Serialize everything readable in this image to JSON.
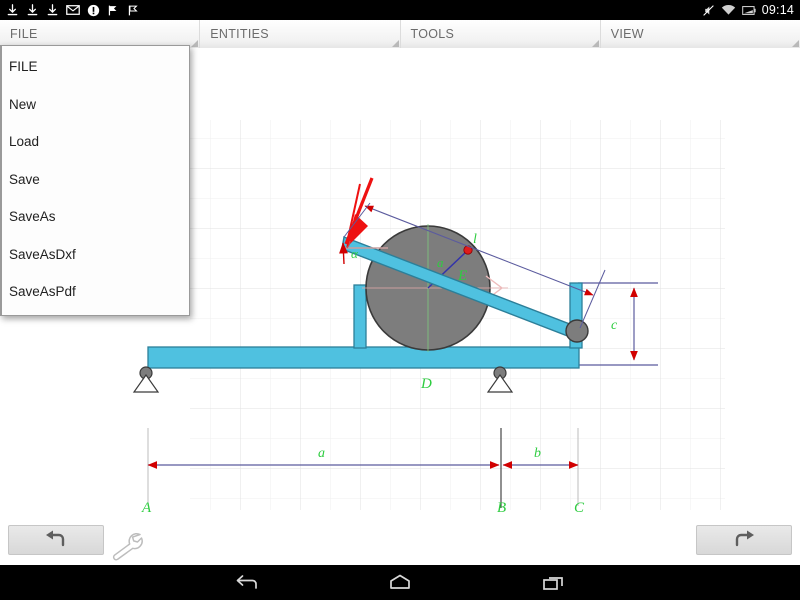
{
  "statusbar": {
    "icons": [
      "download-icon",
      "download-icon",
      "download-icon",
      "mail-icon",
      "alert-icon",
      "flag-icon",
      "flag-outline-icon"
    ],
    "right_icons": [
      "mute-icon",
      "wifi-icon",
      "battery-icon"
    ],
    "clock": "09:14"
  },
  "tabs": [
    {
      "label": "FILE",
      "name": "tab-file",
      "active": true
    },
    {
      "label": "ENTITIES",
      "name": "tab-entities",
      "active": false
    },
    {
      "label": "TOOLS",
      "name": "tab-tools",
      "active": false
    },
    {
      "label": "VIEW",
      "name": "tab-view",
      "active": false
    }
  ],
  "menu": {
    "header": "FILE",
    "items": [
      {
        "label": "FILE"
      },
      {
        "label": "New"
      },
      {
        "label": "Load"
      },
      {
        "label": "Save"
      },
      {
        "label": "SaveAs"
      },
      {
        "label": "SaveAsDxf"
      },
      {
        "label": "SaveAsPdf"
      }
    ]
  },
  "canvas": {
    "background": "#ffffff",
    "grid_color": "#e8e8e8",
    "grid_minor_color": "#f2f2f2",
    "beam_color": "#4fc1e0",
    "beam_stroke": "#2a7f96",
    "disc_color": "#7a7a7a",
    "disc_stroke": "#3a3a3a",
    "support_color": "#6f6f6f",
    "dimension_color": "#5b5b9e",
    "arrow_color": "#d40000",
    "force_color": "#ee1111",
    "label_color": "#2ecc40",
    "labels": {
      "angle": "α",
      "length_l": "l",
      "beam_E": "E",
      "beam_D": "D",
      "radius_a": "a",
      "height_c": "c",
      "dim_a": "a",
      "dim_b": "b",
      "point_A": "A",
      "point_B": "B",
      "point_C": "C"
    }
  },
  "bottombar": {
    "undo_label": "undo-arrow",
    "redo_label": "redo-arrow",
    "settings_label": "wrench-icon"
  },
  "navbar": {
    "back": "back-icon",
    "home": "home-icon",
    "recents": "recents-icon"
  }
}
